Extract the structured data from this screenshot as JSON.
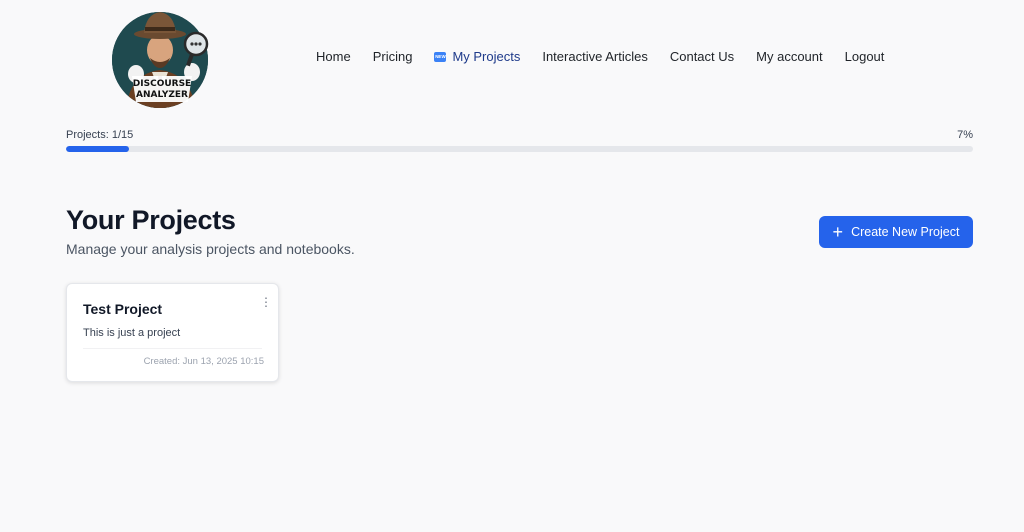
{
  "logo": {
    "text": "DISCOURSE ANALYZER",
    "line1": "DISCOURSE",
    "line2": "ANALYZER"
  },
  "nav": {
    "home": "Home",
    "pricing": "Pricing",
    "new_badge": "NEW",
    "my_projects": "My Projects",
    "interactive_articles": "Interactive Articles",
    "contact_us": "Contact Us",
    "my_account": "My account",
    "logout": "Logout"
  },
  "progress": {
    "label": "Projects: 1/15",
    "percent_text": "7%",
    "fraction": 0.07
  },
  "page": {
    "title": "Your Projects",
    "subtitle": "Manage your analysis projects and notebooks."
  },
  "create_button": {
    "icon": "plus-icon",
    "label": "Create New Project"
  },
  "projects": [
    {
      "title": "Test Project",
      "description": "This is just a project",
      "created": "Created: Jun 13, 2025 10:15",
      "menu_icon": "more-vertical-icon"
    }
  ],
  "colors": {
    "accent": "#2563eb",
    "background": "#f9f9fa",
    "active_nav": "#1e3a8a"
  }
}
